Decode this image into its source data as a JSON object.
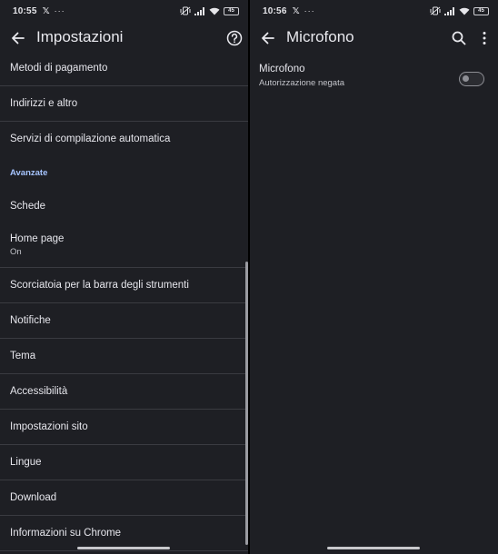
{
  "left": {
    "status": {
      "time": "10:55",
      "x_label": "𝕏",
      "dots": "···",
      "battery": "45"
    },
    "title": "Impostazioni",
    "items_top": [
      {
        "label": "Metodi di pagamento"
      },
      {
        "label": "Indirizzi e altro"
      },
      {
        "label": "Servizi di compilazione automatica"
      }
    ],
    "section": "Avanzate",
    "items_advanced": [
      {
        "label": "Schede"
      },
      {
        "label": "Home page",
        "sub": "On"
      },
      {
        "label": "Scorciatoia per la barra degli strumenti"
      },
      {
        "label": "Notifiche"
      },
      {
        "label": "Tema"
      },
      {
        "label": "Accessibilità"
      },
      {
        "label": "Impostazioni sito"
      },
      {
        "label": "Lingue"
      },
      {
        "label": "Download"
      },
      {
        "label": "Informazioni su Chrome"
      }
    ],
    "icons": {
      "back": "arrow-left-icon",
      "help": "help-circle-icon"
    }
  },
  "right": {
    "status": {
      "time": "10:56",
      "x_label": "𝕏",
      "dots": "···",
      "battery": "45"
    },
    "title": "Microfono",
    "permission": {
      "label": "Microfono",
      "sub": "Autorizzazione negata",
      "enabled": false
    },
    "icons": {
      "back": "arrow-left-icon",
      "search": "search-icon",
      "menu": "more-vert-icon"
    }
  },
  "colors": {
    "background": "#1e1f24",
    "divider": "#3a3b41",
    "accent": "#a6c4ff",
    "text": "#e6e6ec"
  }
}
